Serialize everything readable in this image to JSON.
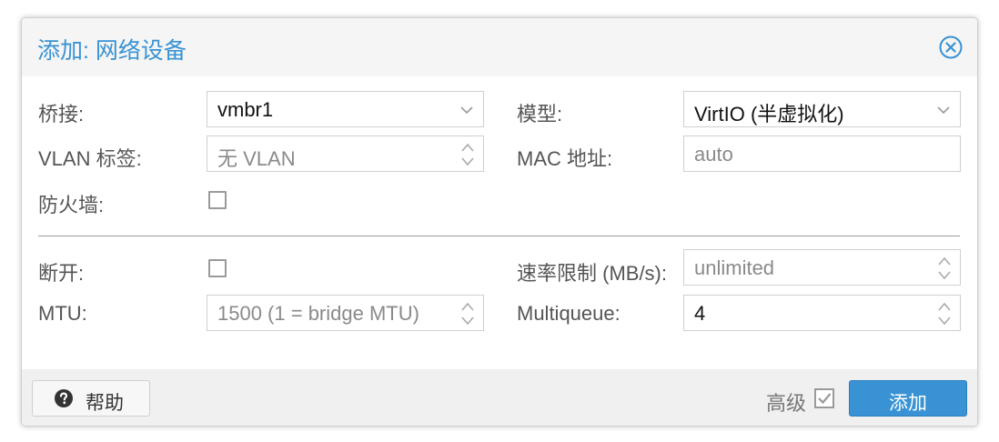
{
  "dialog": {
    "title": "添加: 网络设备",
    "close_icon": "close-circle-icon"
  },
  "form": {
    "bridge": {
      "label": "桥接:",
      "value": "vmbr1"
    },
    "model": {
      "label": "模型:",
      "value": "VirtIO (半虚拟化)"
    },
    "vlan_tag": {
      "label": "VLAN 标签:",
      "placeholder": "无 VLAN"
    },
    "mac_address": {
      "label": "MAC 地址:",
      "placeholder": "auto"
    },
    "firewall": {
      "label": "防火墙:",
      "checked": false
    },
    "disconnect": {
      "label": "断开:",
      "checked": false
    },
    "rate_limit": {
      "label": "速率限制 (MB/s):",
      "placeholder": "unlimited"
    },
    "mtu": {
      "label": "MTU:",
      "placeholder": "1500 (1 = bridge MTU)"
    },
    "multiqueue": {
      "label": "Multiqueue:",
      "value": "4"
    }
  },
  "footer": {
    "help_label": "帮助",
    "help_icon": "question-circle-icon",
    "advanced_label": "高级",
    "advanced_checked": true,
    "add_label": "添加"
  },
  "colors": {
    "accent": "#3892d4",
    "label": "#555555",
    "placeholder": "#8a8a8a"
  }
}
